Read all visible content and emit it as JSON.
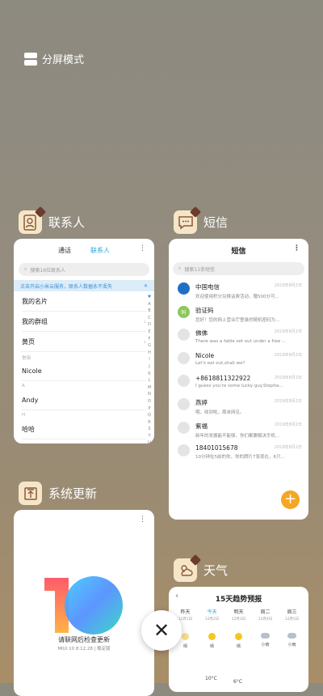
{
  "split_label": "分屏模式",
  "apps": {
    "contacts": "联系人",
    "sms": "短信",
    "update": "系统更新",
    "weather": "天气"
  },
  "contacts": {
    "tabs": [
      "通话",
      "联系人"
    ],
    "search_placeholder": "搜索16位联系人",
    "banner": "点击开启小米云服务，联系人数据永不丢失",
    "my_card": "我的名片",
    "my_groups": "我的群组",
    "yellow_pages": "黄页",
    "group_label": "常用",
    "items": [
      {
        "group": "",
        "name": "Nicole"
      },
      {
        "group": "A",
        "name": "Andy"
      },
      {
        "group": "H",
        "name": "哈哈"
      }
    ],
    "alphabet": [
      "♥",
      "A",
      "B",
      "C",
      "D",
      "E",
      "F",
      "G",
      "H",
      "I",
      "J",
      "K",
      "L",
      "M",
      "N",
      "O",
      "P",
      "Q",
      "R",
      "S",
      "T",
      "U",
      "V",
      "W",
      "X",
      "Y",
      "Z",
      "#"
    ]
  },
  "sms": {
    "title": "短信",
    "search_placeholder": "搜索11条短信",
    "messages": [
      {
        "name": "中国电信",
        "preview": "欢迎使用积分兑换话费活动，赠500分可...",
        "time": "2019年8月2日"
      },
      {
        "name": "验证码",
        "preview": "您好！您的网上营业厅登录的随机密码为...",
        "time": ""
      },
      {
        "name": "佛佛",
        "preview": "There was a fable set out under a free ...",
        "time": "2019年8月2日"
      },
      {
        "name": "Nicole",
        "preview": "Let's eat out,shall we?",
        "time": "2019年8月2日"
      },
      {
        "name": "+8618811322922",
        "preview": "I guess you're some lucky guy.Stepha...",
        "time": "2019年8月2日"
      },
      {
        "name": "燕婷",
        "preview": "哦，收到啦，周末网见。",
        "time": "2019年8月2日"
      },
      {
        "name": "紫福",
        "preview": "新年的发展能不能够，你们都要解决手机...",
        "time": "2019年8月2日"
      },
      {
        "name": "18401015678",
        "preview": "10分钟在5前的你，你的牌片7张现在，6只...",
        "time": "2019年8月2日"
      }
    ]
  },
  "update": {
    "title": "请联网后检查更新",
    "version": "MIUI 10 8.12.28 | 稳定版"
  },
  "weather": {
    "title": "15天趋势预报",
    "days": [
      {
        "label": "昨天",
        "date": "12月1日"
      },
      {
        "label": "今天",
        "date": "12月2日"
      },
      {
        "label": "明天",
        "date": "12月3日"
      },
      {
        "label": "周二",
        "date": "12月4日"
      },
      {
        "label": "周三",
        "date": "12月5日"
      }
    ],
    "conditions": [
      "晴",
      "晴",
      "晴",
      "小雨",
      "小雨"
    ],
    "temps": [
      "10°C",
      "6°C"
    ]
  },
  "colors": {
    "accent_blue": "#2ba4d8",
    "fab_orange": "#f5a623"
  }
}
